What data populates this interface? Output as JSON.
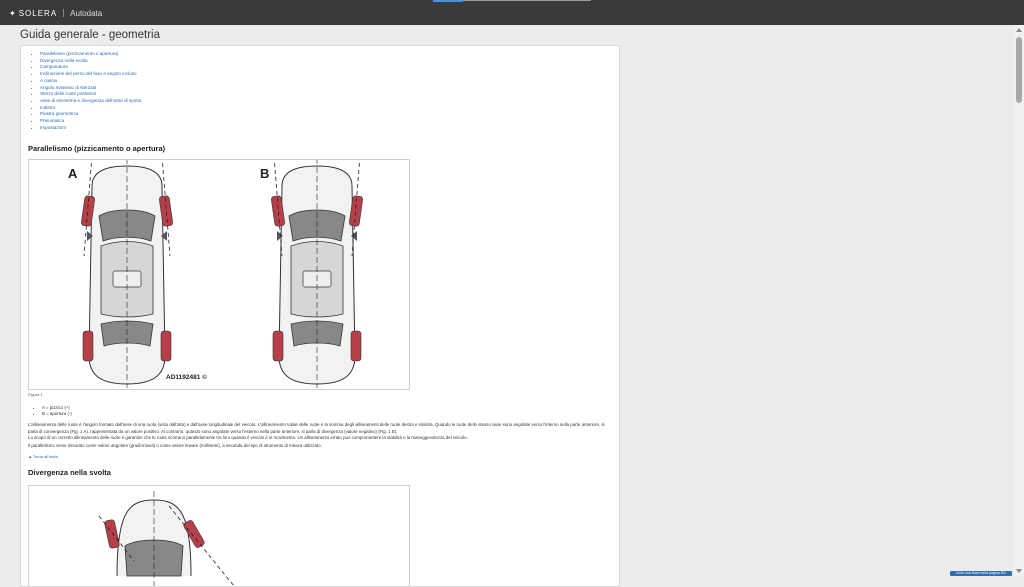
{
  "header": {
    "brand": "SOLERA",
    "product": "Autodata"
  },
  "page": {
    "title": "Guida generale - geometria"
  },
  "toc": [
    "Parallelismo (pizzicamento o apertura)",
    "Divergenza nella svolta",
    "Campanatura",
    "Inclinazione del perno del fuso e angolo incluso",
    "A cascia",
    "Angolo massimo di sterzata",
    "Sterzo delle ruote posteriori",
    "Asse di simmetria e divergenza dell'asse di spinta",
    "Indietro",
    "Piastra geometrica",
    "Pneumatica",
    "Impostazioni"
  ],
  "section1": {
    "title": "Parallelismo (pizzicamento o apertura)",
    "label_a": "A",
    "label_b": "B",
    "figure_code": "AD1192481 ©",
    "caption": "Figura 1",
    "legend": [
      "A = pizzico (+)",
      "B = apertura (-)"
    ],
    "paragraphs": [
      "L'allineamento delle ruote è l'angolo formato dall'asse di una ruota (visto dall'alto) e dall'asse longitudinale del veicolo. L'allineamento totale delle ruote è la somma degli allineamenti delle ruote destra e sinistra. Quando le ruote dello stesso asse sono angolate verso l'interno nella parte anteriore, si parla di convergenza (Fig. 1 A), rappresentata da un valore positivo. Al contrario, quando sono angolate verso l'esterno nella parte anteriore, si parla di divergenza (valore negativo) (Fig. 1 B).",
      "Lo scopo di un corretto allineamento delle ruote è garantire che le ruote scorrano parallelamente tra loro quando il veicolo è in movimento. Un allineamento errato può compromettere la stabilità e la maneggevolezza del veicolo.",
      "Il parallelismo viene misurato come valore angolare (gradi-minuti) o come valore lineare (millimetri), a seconda del tipo di strumento di misura utilizzato."
    ],
    "back_link": "▲ Torna all'inizio"
  },
  "section2": {
    "title": "Divergenza nella svolta"
  },
  "footer_badge": "Invia una linea nella pagina iEx",
  "colors": {
    "topbar": "#3a3a3a",
    "link": "#2b6cb0",
    "wheel": "#b5404a"
  }
}
